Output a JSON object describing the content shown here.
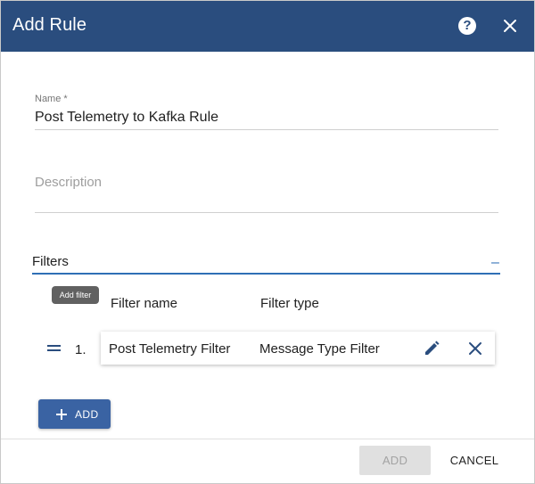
{
  "dialog": {
    "title": "Add Rule",
    "help_icon": "help-circle-icon",
    "help_glyph": "?",
    "close_icon": "close-icon"
  },
  "name": {
    "label": "Name *",
    "value": "Post Telemetry to Kafka Rule"
  },
  "description": {
    "placeholder": "Description",
    "value": ""
  },
  "filters": {
    "title": "Filters",
    "collapse_glyph": "–",
    "tooltip": "Add filter",
    "columns": [
      "Filter name",
      "Filter type"
    ],
    "rows": [
      {
        "index": "1.",
        "name": "Post Telemetry Filter",
        "type": "Message Type Filter"
      }
    ],
    "add_label": "ADD"
  },
  "footer": {
    "add_label": "ADD",
    "cancel_label": "CANCEL"
  },
  "colors": {
    "header": "#2a4d7e",
    "accent": "#2f6fb5",
    "add_button": "#3a63a3"
  }
}
